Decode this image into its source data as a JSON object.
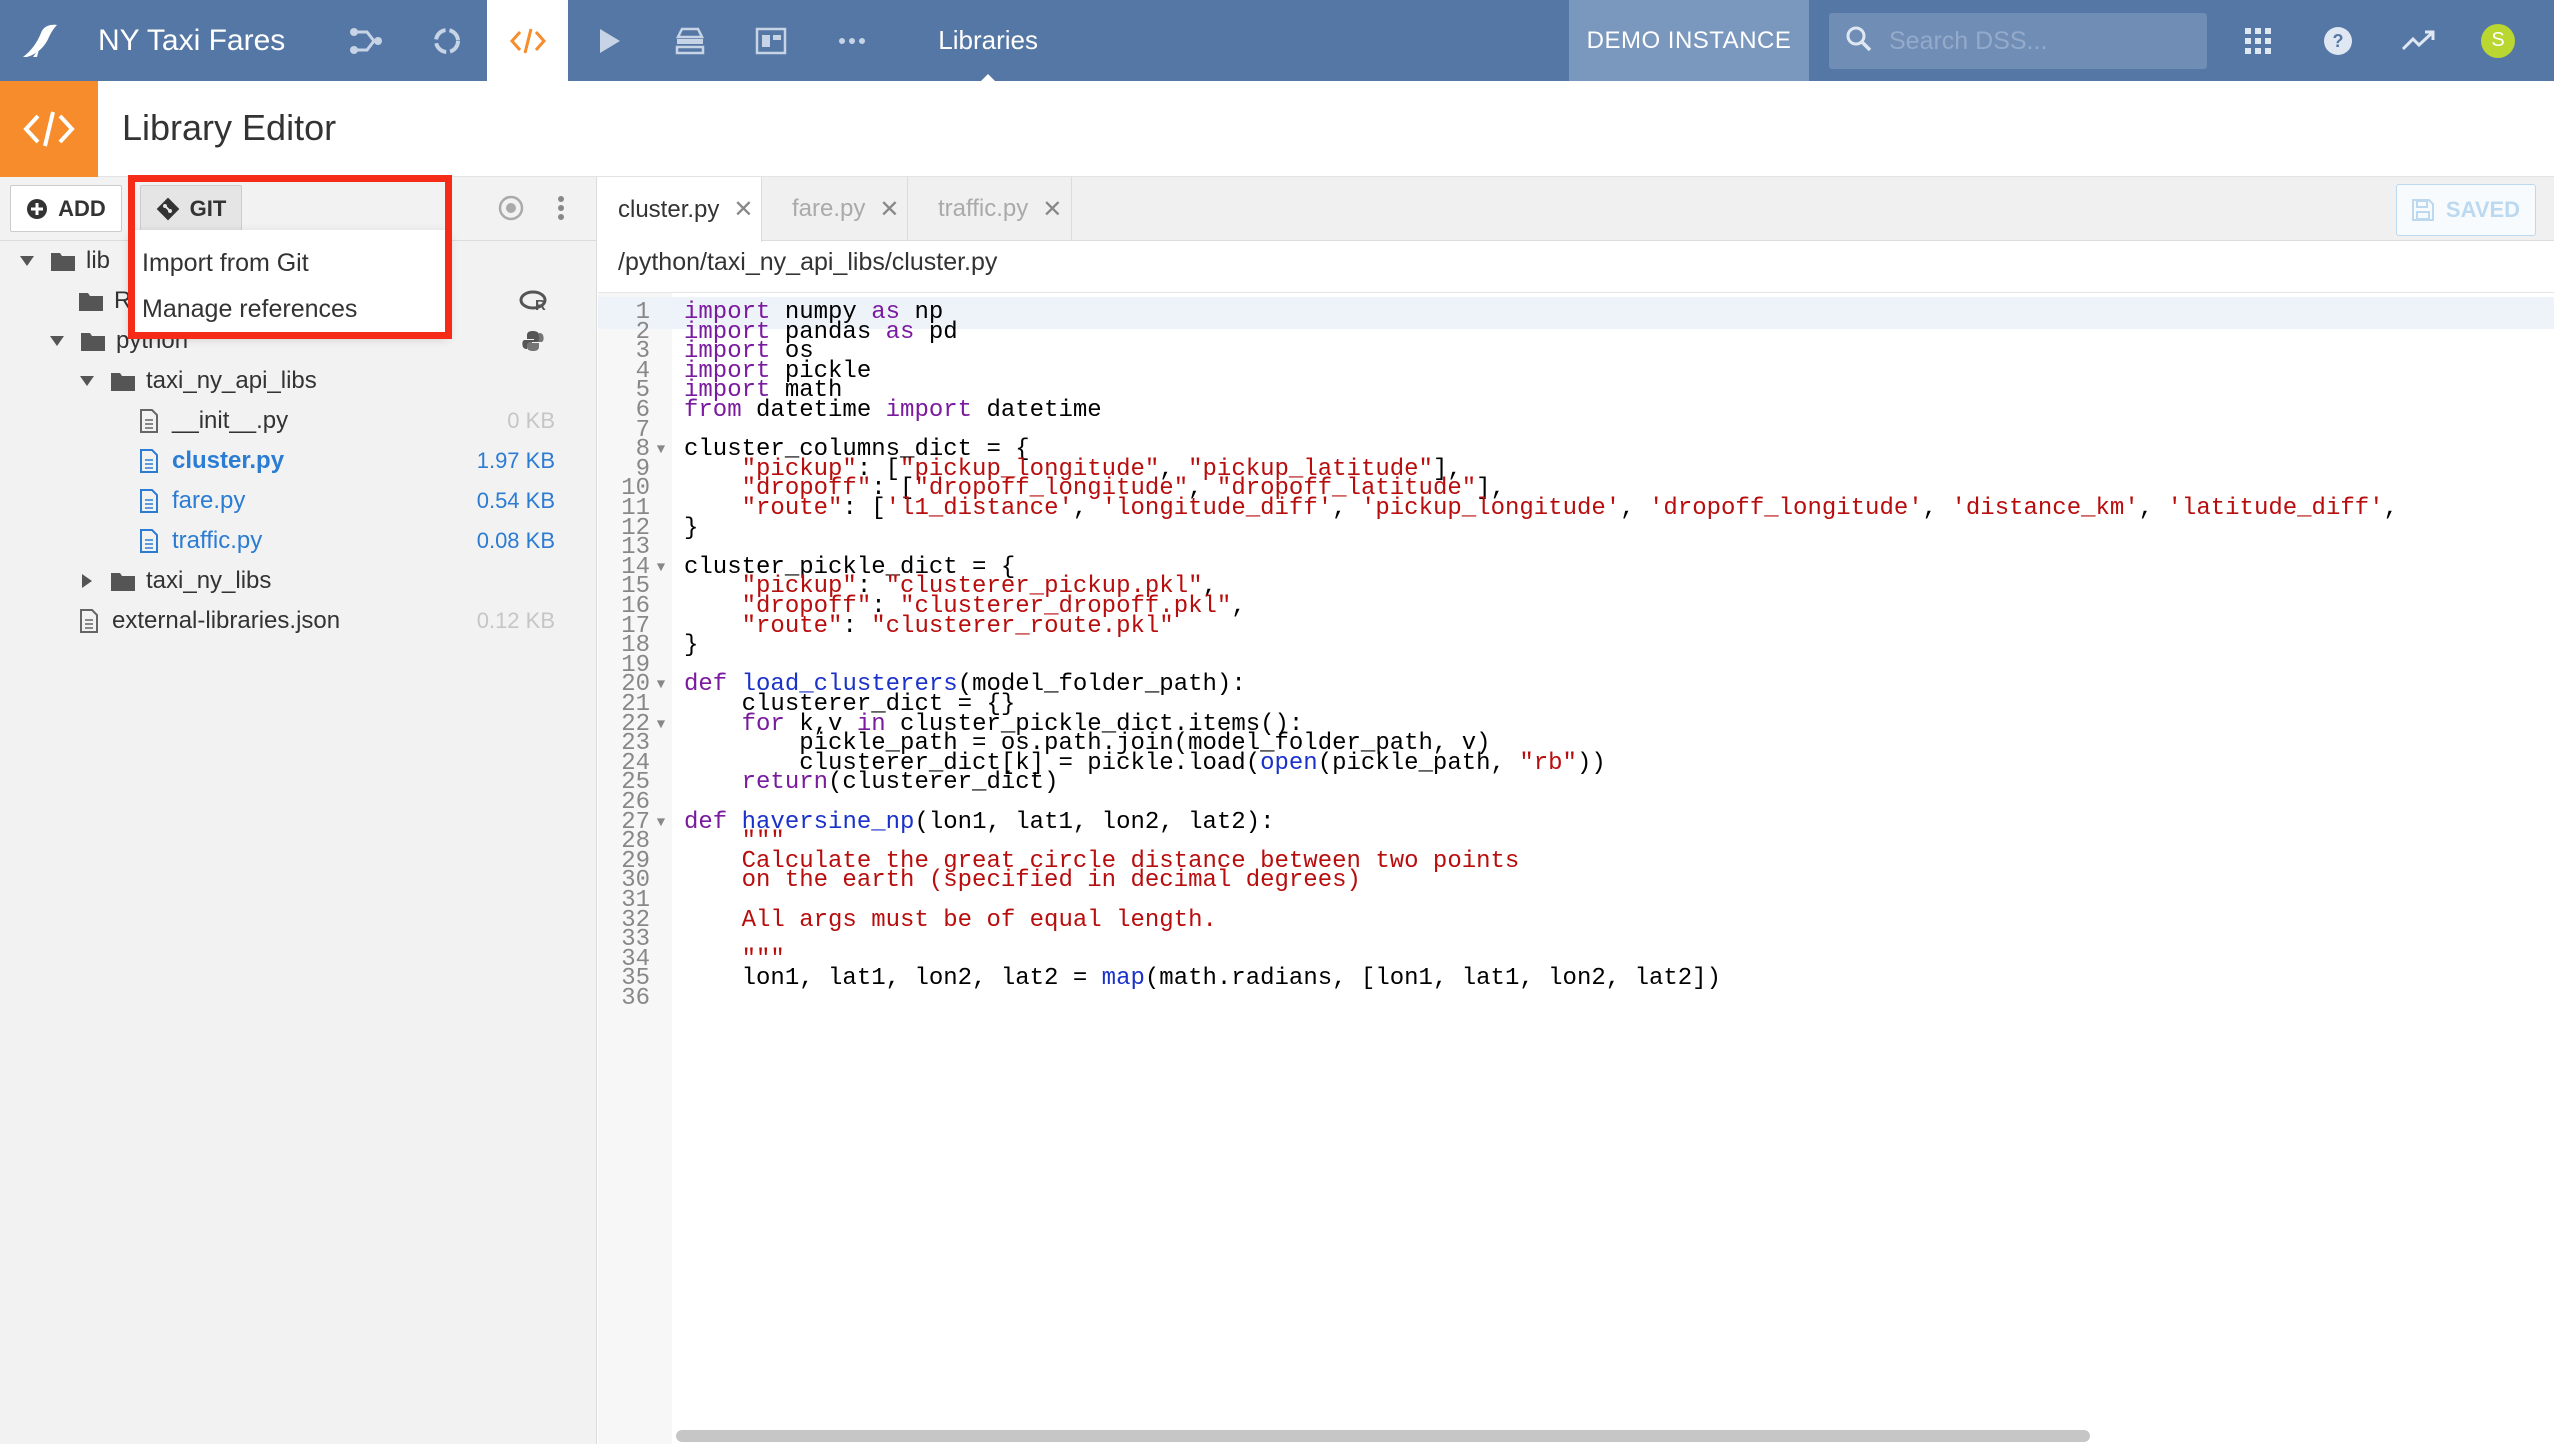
{
  "topnav": {
    "project_title": "NY Taxi Fares",
    "current_section": "Libraries",
    "demo_label": "DEMO INSTANCE",
    "search_placeholder": "Search DSS...",
    "avatar_initial": "S",
    "icons": [
      "bird-logo-icon",
      "flow-icon",
      "cycle-icon",
      "code-icon",
      "play-icon",
      "stack-icon",
      "dashboard-icon",
      "more-icon",
      "apps-grid-icon",
      "help-icon",
      "activity-icon"
    ]
  },
  "page": {
    "title": "Library Editor"
  },
  "sidebar": {
    "add_label": "ADD",
    "git_label": "GIT",
    "tree": [
      {
        "name": "lib",
        "type": "folder",
        "expanded": true,
        "size": ""
      },
      {
        "name": "R",
        "type": "folder",
        "expanded": false,
        "size": ""
      },
      {
        "name": "python",
        "type": "folder",
        "expanded": true,
        "size": ""
      },
      {
        "name": "taxi_ny_api_libs",
        "type": "folder",
        "expanded": true,
        "size": ""
      },
      {
        "name": "__init__.py",
        "type": "file",
        "size": "0 KB"
      },
      {
        "name": "cluster.py",
        "type": "file",
        "size": "1.97 KB",
        "open": true,
        "selected": true
      },
      {
        "name": "fare.py",
        "type": "file",
        "size": "0.54 KB",
        "open": true
      },
      {
        "name": "traffic.py",
        "type": "file",
        "size": "0.08 KB",
        "open": true
      },
      {
        "name": "taxi_ny_libs",
        "type": "folder",
        "expanded": false,
        "size": ""
      },
      {
        "name": "external-libraries.json",
        "type": "file",
        "size": "0.12 KB"
      }
    ]
  },
  "git_menu": {
    "items": [
      "Import from Git",
      "Manage references"
    ]
  },
  "editor": {
    "tabs": [
      {
        "label": "cluster.py",
        "active": true
      },
      {
        "label": "fare.py",
        "active": false
      },
      {
        "label": "traffic.py",
        "active": false
      }
    ],
    "saved_label": "SAVED",
    "path": "/python/taxi_ny_api_libs/cluster.py",
    "lines": [
      "import numpy as np",
      "import pandas as pd",
      "import os",
      "import pickle",
      "import math",
      "from datetime import datetime",
      "",
      "cluster_columns_dict = {",
      "    \"pickup\": [\"pickup_longitude\", \"pickup_latitude\"],",
      "    \"dropoff\": [\"dropoff_longitude\", \"dropoff_latitude\"],",
      "    \"route\": ['l1_distance', 'longitude_diff', 'pickup_longitude', 'dropoff_longitude', 'distance_km', 'latitude_diff',",
      "}",
      "",
      "cluster_pickle_dict = {",
      "    \"pickup\": \"clusterer_pickup.pkl\",",
      "    \"dropoff\": \"clusterer_dropoff.pkl\",",
      "    \"route\": \"clusterer_route.pkl\"",
      "}",
      "",
      "def load_clusterers(model_folder_path):",
      "    clusterer_dict = {}",
      "    for k,v in cluster_pickle_dict.items():",
      "        pickle_path = os.path.join(model_folder_path, v)",
      "        clusterer_dict[k] = pickle.load(open(pickle_path, \"rb\"))",
      "    return(clusterer_dict)",
      "",
      "def haversine_np(lon1, lat1, lon2, lat2):",
      "    \"\"\"",
      "    Calculate the great circle distance between two points",
      "    on the earth (specified in decimal degrees)",
      "",
      "    All args must be of equal length.",
      "",
      "    \"\"\"",
      "    lon1, lat1, lon2, lat2 = map(math.radians, [lon1, lat1, lon2, lat2])",
      ""
    ],
    "fold_lines": [
      8,
      14,
      20,
      22,
      27
    ],
    "current_line": 1
  }
}
